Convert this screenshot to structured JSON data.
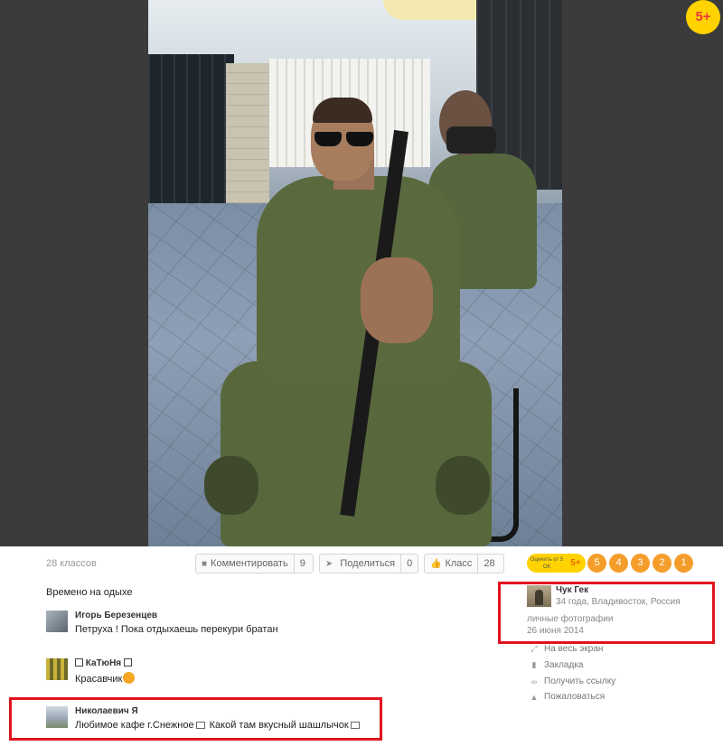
{
  "badge": {
    "age": "5+"
  },
  "actions": {
    "likes_text": "28 классов",
    "comment_label": "Комментировать",
    "comment_count": "9",
    "share_label": "Поделиться",
    "share_count": "0",
    "like_label": "Класс",
    "like_count": "28"
  },
  "rating": {
    "label": "Оценить от 5 ОК",
    "plus": "5+",
    "options": [
      "5",
      "4",
      "3",
      "2",
      "1"
    ],
    "color": "#f59d2a",
    "accent": "#ffd200"
  },
  "description": "Времено на одыхе",
  "comments": [
    {
      "author": "Игорь Березенцев",
      "text": "Петруха ! Пока отдыхаешь перекури братан"
    },
    {
      "author": "КаТюНя",
      "text": "Красавчик"
    },
    {
      "author": "Николаевич Я",
      "text_a": "Любимое кафе г.Снежное",
      "text_b": " Какой там вкусный шашлычок"
    }
  ],
  "owner": {
    "name": "Чук Гек",
    "info": "34 года, Владивосток, Россия",
    "album": "личные фотографии",
    "date": "26 июня 2014"
  },
  "side_links": [
    {
      "label": "На весь экран",
      "icon": "expand-icon"
    },
    {
      "label": "Закладка",
      "icon": "bookmark-icon"
    },
    {
      "label": "Получить ссылку",
      "icon": "link-icon"
    },
    {
      "label": "Пожаловаться",
      "icon": "warning-icon"
    }
  ],
  "highlight_color": "#e0141e"
}
